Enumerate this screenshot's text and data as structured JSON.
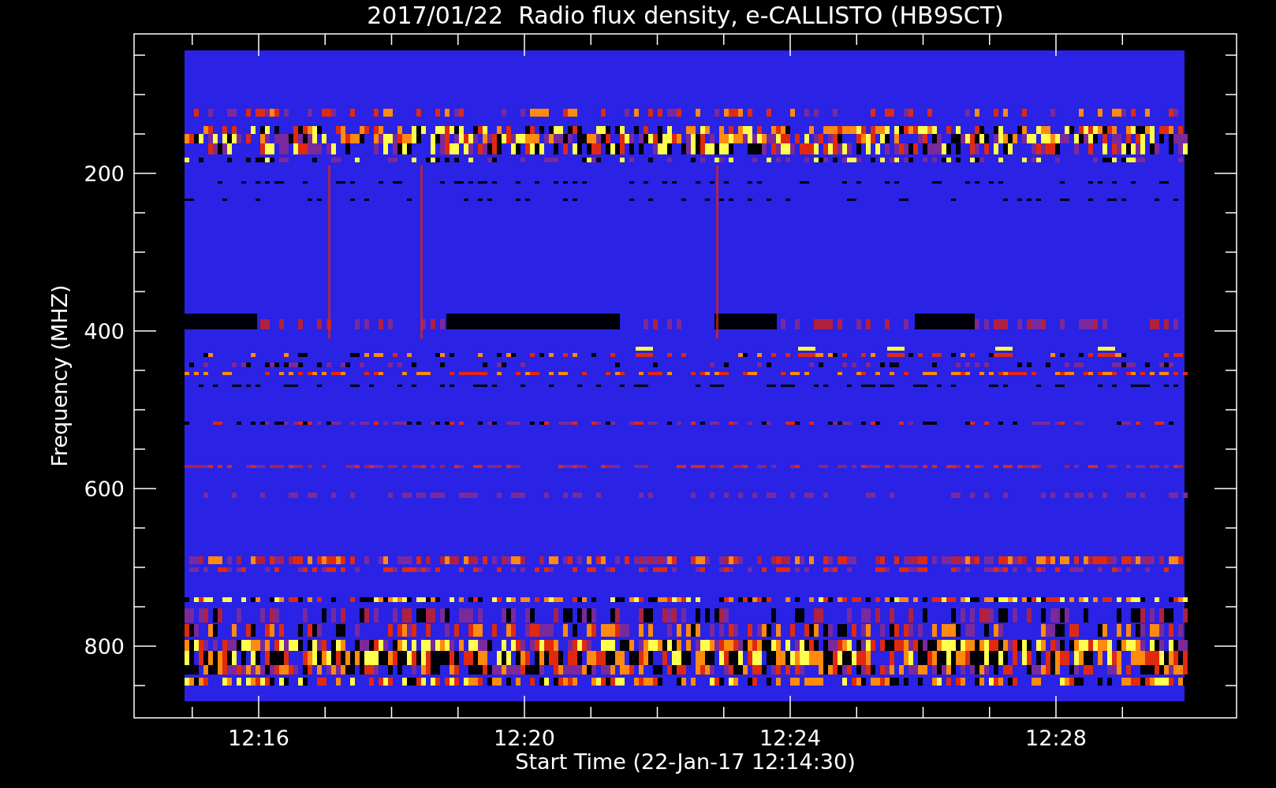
{
  "title": "2017/01/22  Radio flux density, e-CALLISTO (HB9SCT)",
  "y_axis": {
    "title": "Frequency (MHZ)",
    "ticks": [
      "200",
      "400",
      "600",
      "800"
    ]
  },
  "x_axis": {
    "title": "Start Time (22-Jan-17 12:14:30)",
    "ticks": [
      "12:16",
      "12:20",
      "12:24",
      "12:28"
    ]
  }
}
